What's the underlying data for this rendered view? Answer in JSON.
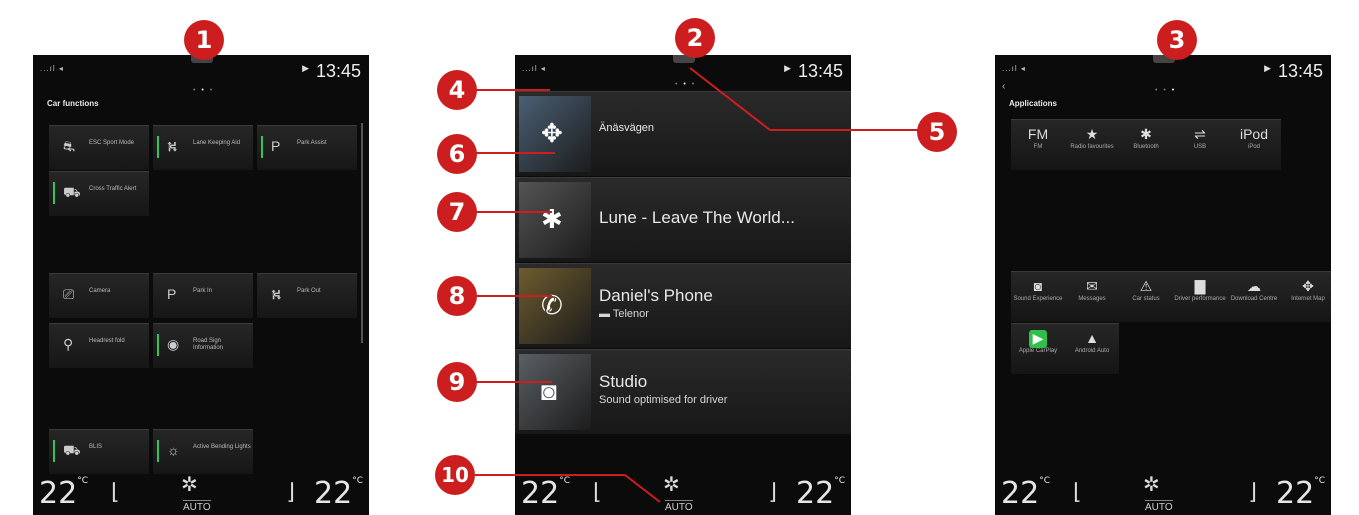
{
  "markers": {
    "m1": "1",
    "m2": "2",
    "m3": "3",
    "m4": "4",
    "m5": "5",
    "m6": "6",
    "m7": "7",
    "m8": "8",
    "m9": "9",
    "m10": "10"
  },
  "status": {
    "signal": "...ıl ◂",
    "time": "13:45",
    "nav_arrow": "▶"
  },
  "pager": {
    "left": "• ",
    "mid": "•",
    "right": " •"
  },
  "screen1": {
    "title": "Car functions",
    "tiles": [
      {
        "icon": "esc-icon",
        "glyph": "⛐",
        "label": "ESC Sport Mode",
        "active": false
      },
      {
        "icon": "lane-keeping-icon",
        "glyph": "⛕",
        "label": "Lane Keeping Aid",
        "active": true
      },
      {
        "icon": "park-assist-icon",
        "glyph": "P",
        "label": "Park Assist",
        "active": true
      },
      {
        "icon": "cross-traffic-icon",
        "glyph": "⛟",
        "label": "Cross Traffic Alert",
        "active": true
      },
      {
        "icon": "camera-icon",
        "glyph": "⎚",
        "label": "Camera",
        "active": false
      },
      {
        "icon": "park-in-icon",
        "glyph": "P",
        "label": "Park In",
        "active": false
      },
      {
        "icon": "park-out-icon",
        "glyph": "⛕",
        "label": "Park Out",
        "active": false
      },
      {
        "icon": "headrest-icon",
        "glyph": "⚲",
        "label": "Headrest fold",
        "active": false
      },
      {
        "icon": "road-sign-icon",
        "glyph": "◉",
        "label": "Road Sign Information",
        "active": true
      },
      {
        "icon": "blis-icon",
        "glyph": "⛟",
        "label": "BLIS",
        "active": true
      },
      {
        "icon": "bending-lights-icon",
        "glyph": "☼",
        "label": "Active Bending Lights",
        "active": true
      }
    ]
  },
  "screen2": {
    "rows": [
      {
        "icon": "navigation-icon",
        "glyph": "✥",
        "title": "Änäsvägen",
        "subtitle": "",
        "img": "#4a5f74"
      },
      {
        "icon": "bluetooth-icon",
        "glyph": "✱",
        "title": "Lune - Leave The World...",
        "subtitle": "",
        "img": "#545454"
      },
      {
        "icon": "phone-icon",
        "glyph": "✆",
        "title": "Daniel's Phone",
        "subtitle": "▬ Telenor",
        "img": "#6e5c2e"
      },
      {
        "icon": "speaker-icon",
        "glyph": "◙",
        "title": "Studio",
        "subtitle": "Sound optimised for driver",
        "img": "#5a5f63"
      }
    ]
  },
  "screen3": {
    "back": "‹",
    "title": "Applications",
    "apps": [
      {
        "icon": "fm-radio-icon",
        "glyph": "FM",
        "label": "FM"
      },
      {
        "icon": "radio-favourites-icon",
        "glyph": "★",
        "label": "Radio favourites"
      },
      {
        "icon": "bluetooth-icon",
        "glyph": "✱",
        "label": "Bluetooth"
      },
      {
        "icon": "usb-icon",
        "glyph": "⇌",
        "label": "USB"
      },
      {
        "icon": "ipod-icon",
        "glyph": "iPod",
        "label": "iPod"
      },
      {
        "icon": "sound-experience-icon",
        "glyph": "◙",
        "label": "Sound Experience"
      },
      {
        "icon": "messages-icon",
        "glyph": "✉",
        "label": "Messages"
      },
      {
        "icon": "car-status-icon",
        "glyph": "⚠",
        "label": "Car status"
      },
      {
        "icon": "driver-performance-icon",
        "glyph": "▇",
        "label": "Driver performance"
      },
      {
        "icon": "download-centre-icon",
        "glyph": "☁",
        "label": "Download Centre"
      },
      {
        "icon": "internet-map-icon",
        "glyph": "✥",
        "label": "Internet Map"
      },
      {
        "icon": "apple-carplay-icon",
        "glyph": "▶",
        "label": "Apple CarPlay"
      },
      {
        "icon": "android-auto-icon",
        "glyph": "▲",
        "label": "Android Auto"
      }
    ]
  },
  "climate": {
    "temp_left": "22",
    "temp_right": "22",
    "unit": "°C",
    "auto": "AUTO"
  }
}
